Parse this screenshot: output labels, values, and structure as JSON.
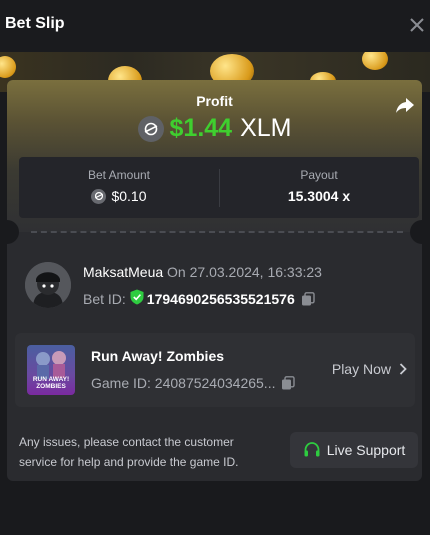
{
  "header": {
    "title": "Bet Slip"
  },
  "profit": {
    "label": "Profit",
    "amount": "$1.44",
    "currency": "XLM"
  },
  "stats": {
    "bet_amount_label": "Bet Amount",
    "bet_amount_value": "$0.10",
    "payout_label": "Payout",
    "payout_value": "15.3004 x"
  },
  "user": {
    "name": "MaksatMeua",
    "on_text": "On 27.03.2024, 16:33:23",
    "bet_id_label": "Bet ID:",
    "bet_id_value": "1794690256535521576"
  },
  "game": {
    "thumb_text": "RUN AWAY! ZOMBIES",
    "name": "Run Away! Zombies",
    "id_text": "Game ID: 24087524034265...",
    "play_label": "Play Now"
  },
  "footer": {
    "note": "Any issues, please contact the customer service for help and provide the game ID.",
    "support_label": "Live Support"
  },
  "colors": {
    "profit": "#3fcf2f",
    "secure": "#2ecc40",
    "support_icon": "#2ecc40"
  }
}
